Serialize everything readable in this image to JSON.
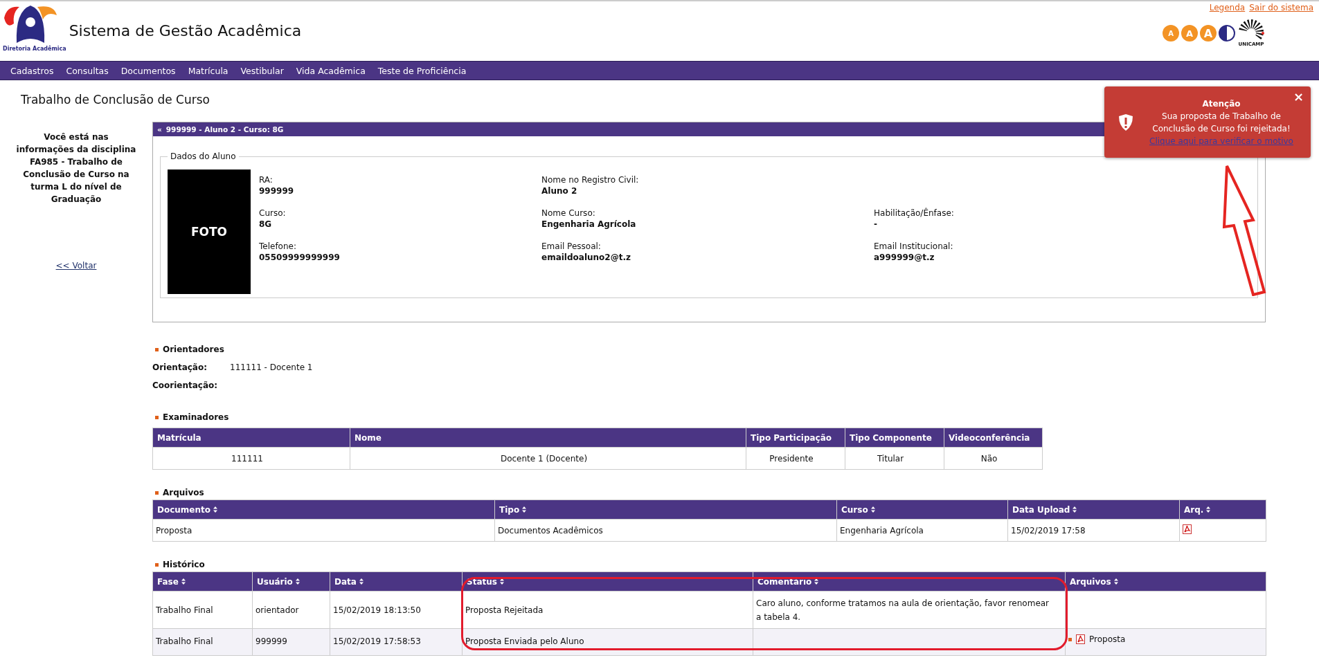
{
  "header": {
    "title": "Sistema de Gestão Acadêmica",
    "logo_caption": "Diretoria Acadêmica",
    "links": [
      "Legenda",
      "Sair do sistema"
    ],
    "font_buttons": [
      "A",
      "A",
      "A"
    ],
    "university": "UNICAMP"
  },
  "menu": [
    "Cadastros",
    "Consultas",
    "Documentos",
    "Matrícula",
    "Vestibular",
    "Vida Acadêmica",
    "Teste de Proficiência"
  ],
  "page_title": "Trabalho de Conclusão de Curso",
  "sidebar": {
    "info": "Você está nas informações da disciplina FA985 - Trabalho de Conclusão de Curso na turma L do nível de Graduação",
    "back_link": "<< Voltar"
  },
  "student_panel": {
    "toggle": "«",
    "heading": "999999 - Aluno 2 - Curso: 8G",
    "legend": "Dados do Aluno",
    "photo_label": "FOTO",
    "field_rows": [
      [
        {
          "label": "RA:",
          "value": "999999"
        },
        {
          "label": "Nome no Registro Civil:",
          "value": "Aluno 2"
        }
      ],
      [
        {
          "label": "Curso:",
          "value": "8G"
        },
        {
          "label": "Nome Curso:",
          "value": "Engenharia Agrícola"
        },
        {
          "label": "Habilitação/Ênfase:",
          "value": "-"
        }
      ],
      [
        {
          "label": "Telefone:",
          "value": "05509999999999"
        },
        {
          "label": "Email Pessoal:",
          "value": "emaildoaluno2@t.z"
        },
        {
          "label": "Email Institucional:",
          "value": "a999999@t.z"
        }
      ]
    ]
  },
  "advisors": {
    "title": "Orientadores",
    "rows": [
      {
        "label": "Orientação:",
        "value": "111111 - Docente 1"
      },
      {
        "label": "Coorientação:"
      }
    ]
  },
  "examiners": {
    "title": "Examinadores",
    "columns": [
      {
        "label": "Matrícula",
        "sortable": false
      },
      {
        "label": "Nome",
        "sortable": false
      },
      {
        "label": "Tipo Participação",
        "sortable": false
      },
      {
        "label": "Tipo Componente",
        "sortable": false
      },
      {
        "label": "Videoconferência",
        "sortable": false
      }
    ],
    "rows": [
      {
        "cells": [
          "111111",
          "Docente 1 (Docente)",
          "Presidente",
          "Titular",
          "Não"
        ]
      }
    ]
  },
  "files": {
    "title": "Arquivos",
    "columns": [
      {
        "label": "Documento",
        "sortable": true
      },
      {
        "label": "Tipo",
        "sortable": true
      },
      {
        "label": "Curso",
        "sortable": true
      },
      {
        "label": "Data Upload",
        "sortable": true
      },
      {
        "label": "Arq.",
        "sortable": true
      }
    ],
    "rows": [
      {
        "cells": [
          "Proposta",
          "Documentos Acadêmicos",
          "Engenharia Agrícola",
          "15/02/2019 17:58"
        ],
        "pdf": true
      }
    ]
  },
  "history": {
    "title": "Histórico",
    "columns": [
      {
        "label": "Fase",
        "sortable": true
      },
      {
        "label": "Usuário",
        "sortable": true
      },
      {
        "label": "Data",
        "sortable": true
      },
      {
        "label": "Status",
        "sortable": true
      },
      {
        "label": "Comentário",
        "sortable": true
      },
      {
        "label": "Arquivos",
        "sortable": true
      }
    ],
    "rows": [
      {
        "cells": [
          "Trabalho Final",
          "orientador",
          "15/02/2019 18:13:50",
          "Proposta Rejeitada",
          "Caro aluno, conforme tratamos na aula de orientação, favor renomear a tabela 4."
        ]
      },
      {
        "cells": [
          "Trabalho Final",
          "999999",
          "15/02/2019 17:58:53",
          "Proposta Enviada pelo Aluno",
          null
        ],
        "attachment": "Proposta"
      }
    ]
  },
  "notification": {
    "title": "Atenção",
    "message": "Sua proposta de Trabalho de Conclusão de Curso foi rejeitada!",
    "link": "Clique aqui para verificar o motivo",
    "close": "×"
  }
}
